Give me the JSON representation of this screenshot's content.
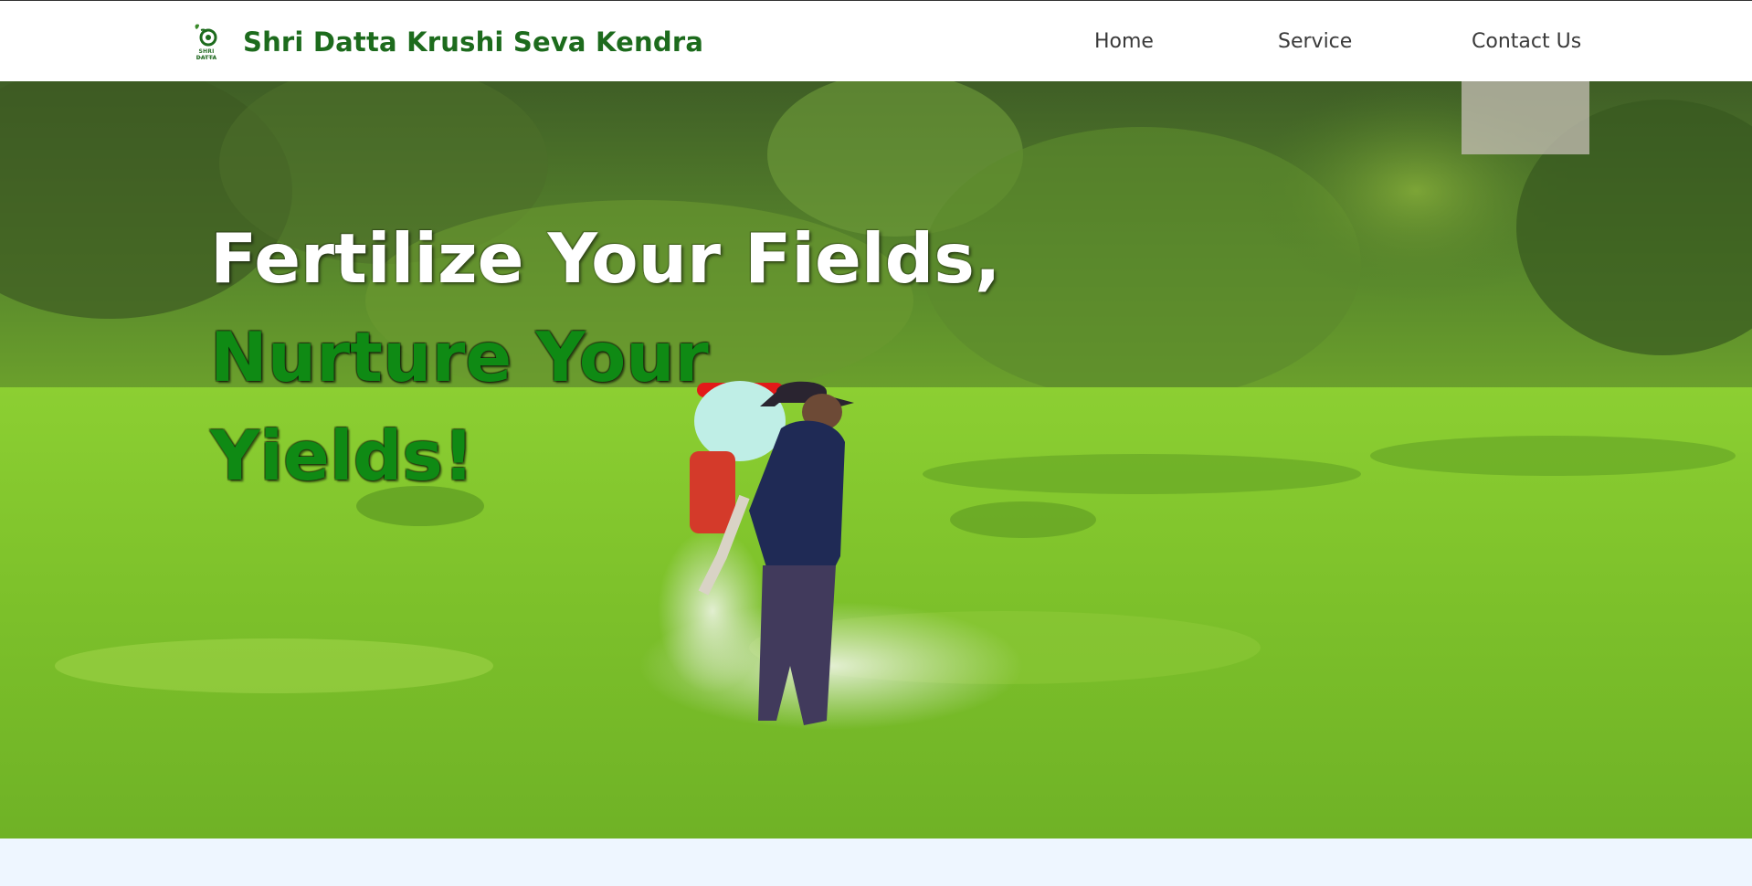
{
  "brand": {
    "logo_text": "SHRI DATTA",
    "logo_subtext": "KRUSHI SEVA",
    "name": "Shri Datta Krushi Seva Kendra"
  },
  "nav": {
    "items": [
      {
        "label": "Home"
      },
      {
        "label": "Service"
      },
      {
        "label": "Contact Us"
      }
    ]
  },
  "hero": {
    "line1": "Fertilize Your Fields,",
    "line2": "Nurture Your",
    "line3": "Yields!"
  },
  "colors": {
    "brand_green": "#1d6b1d",
    "headline_green": "#0f8a14",
    "nav_text": "#3a3a3a",
    "page_bg": "#eef6ff"
  }
}
